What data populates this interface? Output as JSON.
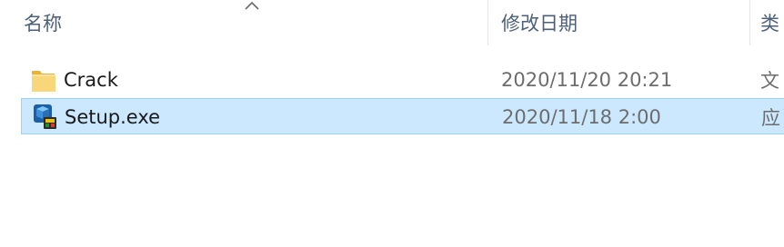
{
  "columns": {
    "name": "名称",
    "date_modified": "修改日期",
    "type": "类"
  },
  "sort": {
    "column": "name",
    "icon": "sort-ascending-chevron-icon"
  },
  "files": [
    {
      "name": "Crack",
      "date_modified": "2020/11/20 20:21",
      "type": "文",
      "icon": "folder-icon",
      "selected": false
    },
    {
      "name": "Setup.exe",
      "date_modified": "2020/11/18 2:00",
      "type": "应",
      "icon": "setup-installer-icon",
      "selected": true
    }
  ],
  "colors": {
    "selection_fill": "#cce8ff",
    "selection_border": "#99d1ff",
    "folder": "#f5c95a",
    "header_text": "#4c607a"
  }
}
